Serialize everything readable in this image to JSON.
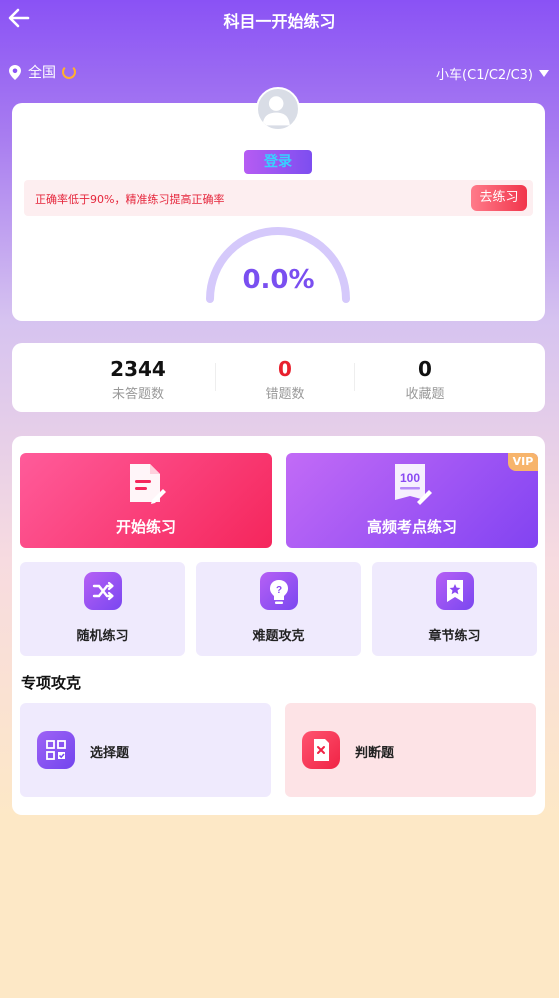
{
  "header": {
    "title": "科目一开始练习"
  },
  "location": {
    "label": "全国",
    "vehicle": "小车(C1/C2/C3)"
  },
  "profile": {
    "login_label": "登录",
    "tip_text": "正确率低于90%，精准练习提高正确率",
    "go_practice_label": "去练习",
    "accuracy_text": "0.0%",
    "accuracy_value": 0.0
  },
  "stats": [
    {
      "value": "2344",
      "label": "未答题数"
    },
    {
      "value": "0",
      "label": "错题数"
    },
    {
      "value": "0",
      "label": "收藏题"
    }
  ],
  "practice": {
    "start_label": "开始练习",
    "high_freq_label": "高频考点练习",
    "high_freq_icon_text": "100",
    "vip_label": "VIP",
    "random_label": "随机练习",
    "hard_label": "难题攻克",
    "chapter_label": "章节练习"
  },
  "special": {
    "title": "专项攻克",
    "choice_label": "选择题",
    "judge_label": "判断题"
  },
  "colors": {
    "accent": "#7a4ff0",
    "error_red": "#e8202e",
    "pink_start": "#ff5b9a",
    "purple_end": "#8243f2"
  }
}
